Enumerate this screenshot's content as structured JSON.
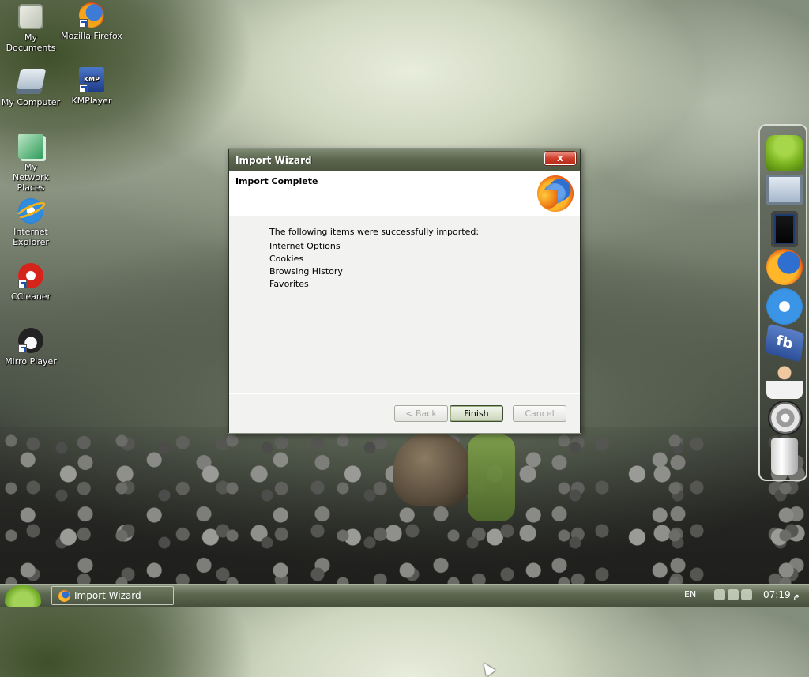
{
  "desktop": {
    "icons": [
      {
        "label": "My Documents",
        "icon": "my-documents-icon"
      },
      {
        "label": "Mozilla Firefox",
        "icon": "firefox-icon"
      },
      {
        "label": "My Computer",
        "icon": "my-computer-icon"
      },
      {
        "label": "KMPlayer",
        "icon": "kmplayer-icon",
        "badge": "KMP"
      },
      {
        "label": "My Network Places",
        "icon": "network-places-icon"
      },
      {
        "label": "Internet Explorer",
        "icon": "internet-explorer-icon"
      },
      {
        "label": "CCleaner",
        "icon": "ccleaner-icon"
      },
      {
        "label": "Mirro Player",
        "icon": "mirro-player-icon"
      }
    ]
  },
  "dialog": {
    "title": "Import Wizard",
    "close_label": "x",
    "header_title": "Import Complete",
    "intro": "The following items were successfully imported:",
    "items": [
      "Internet Options",
      "Cookies",
      "Browsing History",
      "Favorites"
    ],
    "buttons": {
      "back": "< Back",
      "finish": "Finish",
      "cancel": "Cancel"
    }
  },
  "dock": {
    "items": [
      "android-icon",
      "monitor-icon",
      "ipad-icon",
      "firefox-icon",
      "internet-explorer-icon",
      "facebook-icon",
      "user-support-icon",
      "settings-gear-icon",
      "trash-icon"
    ],
    "fb_text": "fb"
  },
  "taskbar": {
    "task_label": "Import Wizard",
    "language": "EN",
    "clock": "07:19 م"
  },
  "colors": {
    "titlebar": "#5c6750",
    "close": "#cf3e2b",
    "taskbar": "#5d6851"
  }
}
